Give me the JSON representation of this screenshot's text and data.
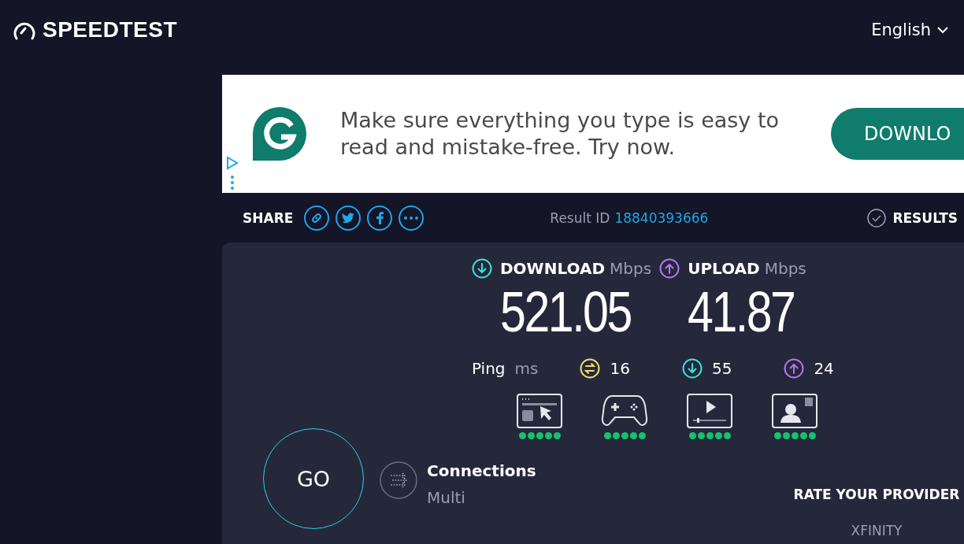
{
  "header": {
    "logo": "SPEEDTEST",
    "language": "English"
  },
  "ad": {
    "text": "Make sure everything you type is easy to read and mistake-free. Try now.",
    "button": "DOWNLO"
  },
  "share": {
    "label": "SHARE"
  },
  "result": {
    "label": "Result ID",
    "id": "18840393666"
  },
  "results_link": "RESULTS",
  "speeds": [
    {
      "kind": "download",
      "label": "DOWNLOAD",
      "unit": "Mbps",
      "value": "521.05"
    },
    {
      "kind": "upload",
      "label": "UPLOAD",
      "unit": "Mbps",
      "value": "41.87"
    }
  ],
  "ping": {
    "label": "Ping",
    "unit": "ms",
    "items": [
      {
        "kind": "idle",
        "value": "16"
      },
      {
        "kind": "download",
        "value": "55"
      },
      {
        "kind": "upload",
        "value": "24"
      }
    ]
  },
  "quality": [
    {
      "kind": "browsing",
      "stars": 5
    },
    {
      "kind": "gaming",
      "stars": 5
    },
    {
      "kind": "streaming",
      "stars": 5
    },
    {
      "kind": "video_call",
      "stars": 5
    }
  ],
  "go": "GO",
  "connections": {
    "label": "Connections",
    "value": "Multi"
  },
  "provider": {
    "title": "RATE YOUR PROVIDER",
    "name": "XFINITY"
  }
}
